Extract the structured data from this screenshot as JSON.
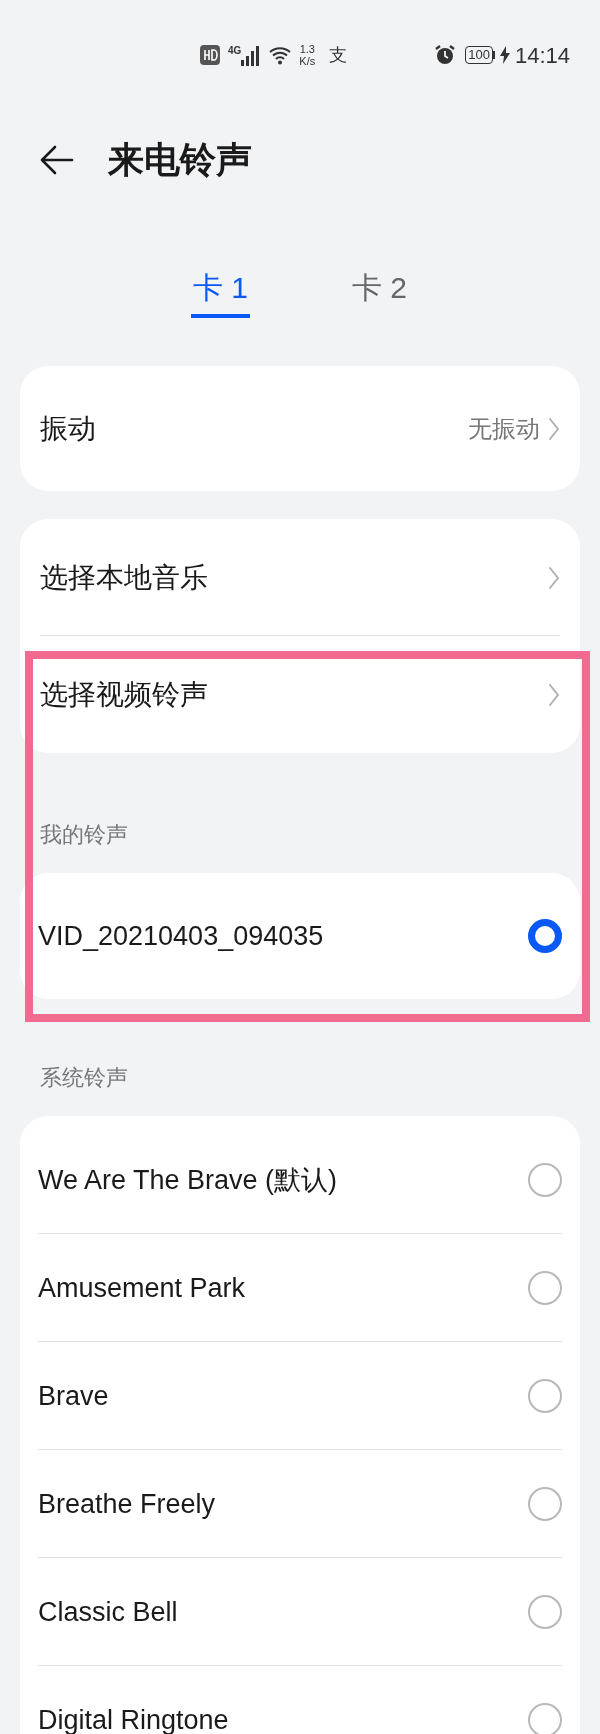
{
  "status_bar": {
    "network": "4G",
    "speed_value": "1.3",
    "speed_unit": "K/s",
    "app_badge": "支",
    "battery": "100",
    "charging": true,
    "time": "14:14"
  },
  "header": {
    "title": "来电铃声"
  },
  "tabs": [
    {
      "label": "卡 1",
      "selected": true
    },
    {
      "label": "卡 2",
      "selected": false
    }
  ],
  "vibration": {
    "label": "振动",
    "value": "无振动"
  },
  "sources": [
    {
      "label": "选择本地音乐"
    },
    {
      "label": "选择视频铃声"
    }
  ],
  "my_ringtones": {
    "title": "我的铃声",
    "items": [
      {
        "name": "VID_20210403_094035",
        "selected": true
      }
    ]
  },
  "system_ringtones": {
    "title": "系统铃声",
    "items": [
      {
        "name": "We Are The Brave (默认)",
        "selected": false
      },
      {
        "name": "Amusement Park",
        "selected": false
      },
      {
        "name": "Brave",
        "selected": false
      },
      {
        "name": "Breathe Freely",
        "selected": false
      },
      {
        "name": "Classic Bell",
        "selected": false
      },
      {
        "name": "Digital Ringtone",
        "selected": false
      }
    ]
  }
}
